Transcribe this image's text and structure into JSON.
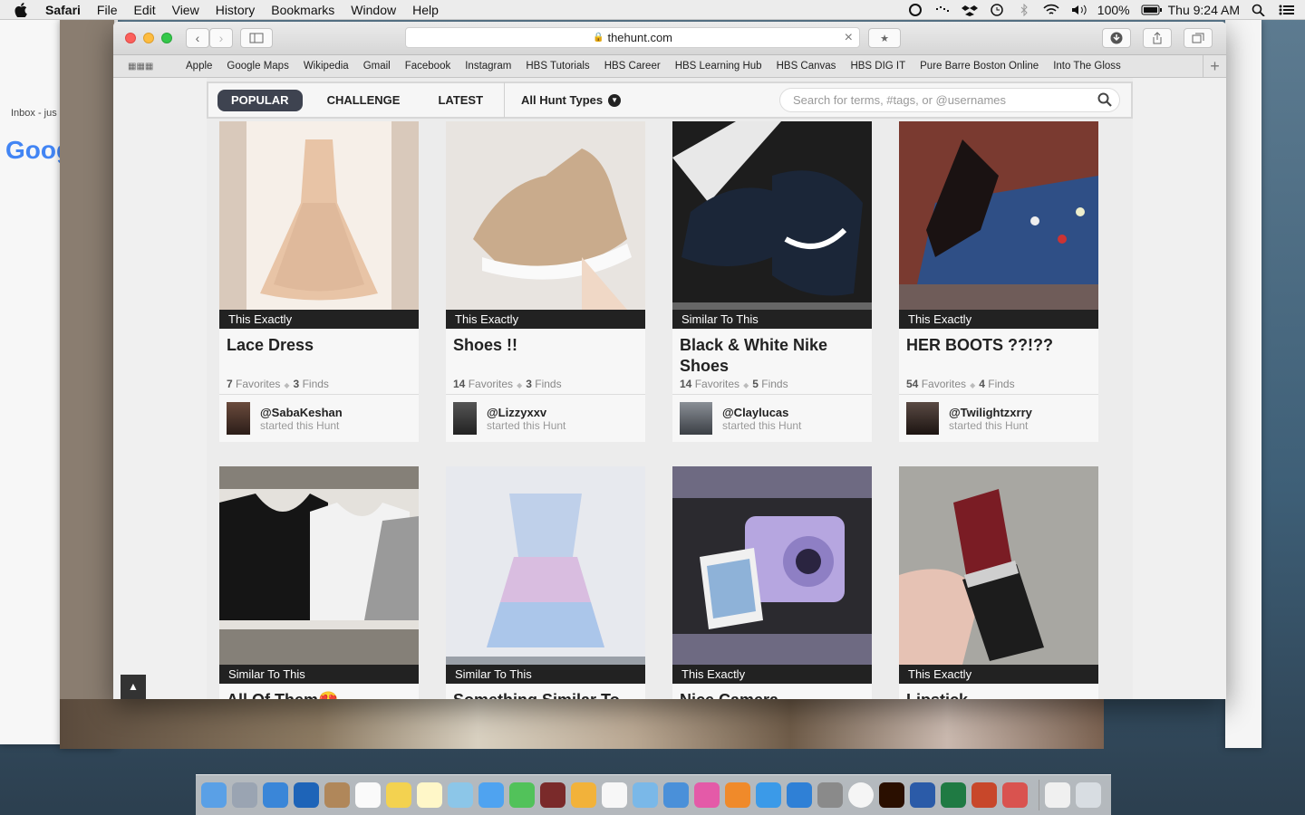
{
  "menubar": {
    "app": "Safari",
    "items": [
      "File",
      "Edit",
      "View",
      "History",
      "Bookmarks",
      "Window",
      "Help"
    ],
    "battery": "100%",
    "clock": "Thu 9:24 AM"
  },
  "background": {
    "inbox_label": "Inbox - jus",
    "google_label": "Goog"
  },
  "browser": {
    "url": "thehunt.com",
    "bookmarks": [
      "Apple",
      "Google Maps",
      "Wikipedia",
      "Gmail",
      "Facebook",
      "Instagram",
      "HBS Tutorials",
      "HBS Career",
      "HBS Learning Hub",
      "HBS Canvas",
      "HBS DIG IT",
      "Pure Barre Boston Online",
      "Into The Gloss"
    ]
  },
  "tabs": {
    "popular": "POPULAR",
    "challenge": "CHALLENGE",
    "latest": "LATEST",
    "types": "All Hunt Types"
  },
  "search": {
    "placeholder": "Search for terms, #tags, or @usernames"
  },
  "labels": {
    "favorites": "Favorites",
    "finds": "Finds",
    "started": "started this Hunt"
  },
  "cards": [
    {
      "badge": "This Exactly",
      "title": "Lace Dress",
      "favorites": "7",
      "finds": "3",
      "user": "@SabaKeshan"
    },
    {
      "badge": "This Exactly",
      "title": "Shoes !!",
      "favorites": "14",
      "finds": "3",
      "user": "@Lizzyxxv"
    },
    {
      "badge": "Similar To This",
      "title": "Black & White Nike Shoes",
      "favorites": "14",
      "finds": "5",
      "user": "@Claylucas"
    },
    {
      "badge": "This Exactly",
      "title": "HER BOOTS ??!??",
      "favorites": "54",
      "finds": "4",
      "user": "@Twilightzxrry"
    },
    {
      "badge": "Similar To This",
      "title": "All Of Them😍"
    },
    {
      "badge": "Similar To This",
      "title": "Something Similar To"
    },
    {
      "badge": "This Exactly",
      "title": "Nice Camera"
    },
    {
      "badge": "This Exactly",
      "title": "Lipstick"
    }
  ]
}
